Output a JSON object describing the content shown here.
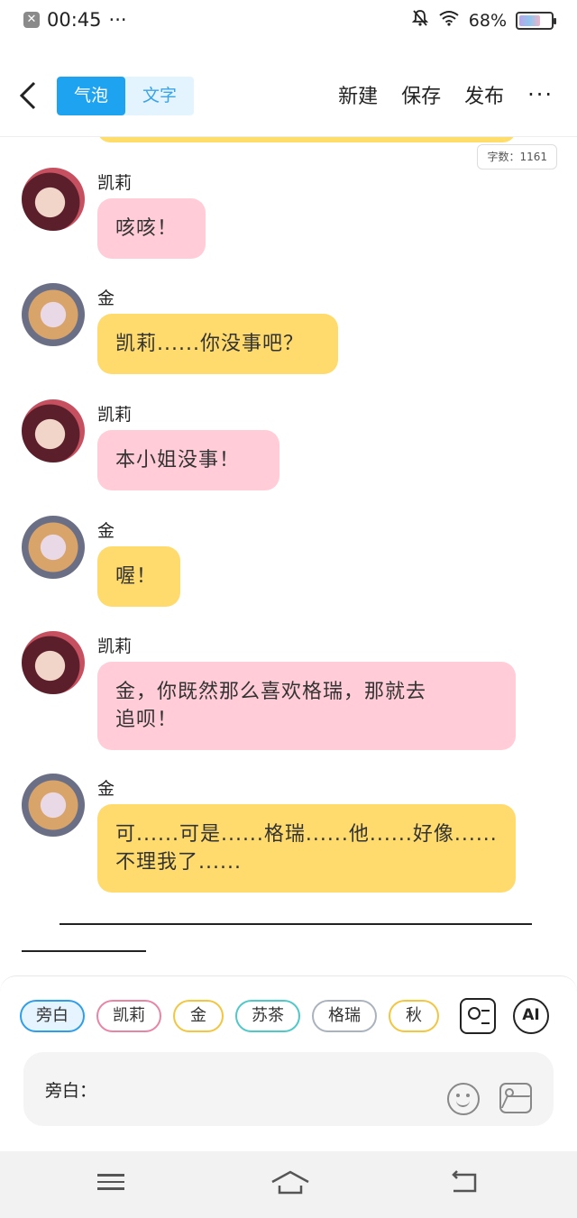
{
  "status": {
    "time": "00:45",
    "dots": "···",
    "battery": "68%",
    "battery_level": 0.68
  },
  "header": {
    "tabs": [
      {
        "label": "气泡",
        "active": true
      },
      {
        "label": "文字",
        "active": false
      }
    ],
    "actions": {
      "new": "新建",
      "save": "保存",
      "publish": "发布",
      "more": "···"
    }
  },
  "word_count": "字数：1161",
  "messages": [
    {
      "speaker": "凯莉",
      "text_lines": [
        "咳咳！"
      ],
      "color": "#ffccd8",
      "avatar": "kelly"
    },
    {
      "speaker": "金",
      "text_lines": [
        "凯莉......你没事吧？"
      ],
      "color": "#ffdb6e",
      "avatar": "jin"
    },
    {
      "speaker": "凯莉",
      "text_lines": [
        "本小姐没事！"
      ],
      "color": "#ffccd8",
      "avatar": "kelly"
    },
    {
      "speaker": "金",
      "text_lines": [
        "喔！"
      ],
      "color": "#ffdb6e",
      "avatar": "jin"
    },
    {
      "speaker": "凯莉",
      "text_lines": [
        "金，你既然那么喜欢格瑞，那就去",
        "追呗！"
      ],
      "color": "#ffccd8",
      "avatar": "kelly"
    },
    {
      "speaker": "金",
      "text_lines": [
        "可......可是......格瑞......他......好像......",
        "不理我了......"
      ],
      "color": "#ffdb6e",
      "avatar": "jin"
    }
  ],
  "characters": [
    {
      "label": "旁白",
      "selected": true
    },
    {
      "label": "凯莉",
      "selected": false
    },
    {
      "label": "金",
      "selected": false
    },
    {
      "label": "苏茶",
      "selected": false
    },
    {
      "label": "格瑞",
      "selected": false
    },
    {
      "label": "秋",
      "selected": false
    }
  ],
  "toolbar": {
    "ai_label": "AI"
  },
  "input": {
    "label": "旁白："
  },
  "colors": {
    "accent": "#1ea3f0",
    "pink_bubble": "#ffccd8",
    "yellow_bubble": "#ffdb6e"
  },
  "icons": [
    "back-arrow-icon",
    "contact-card-icon",
    "ai-icon",
    "emoji-icon",
    "image-icon",
    "menu-icon",
    "home-icon",
    "back-icon"
  ]
}
